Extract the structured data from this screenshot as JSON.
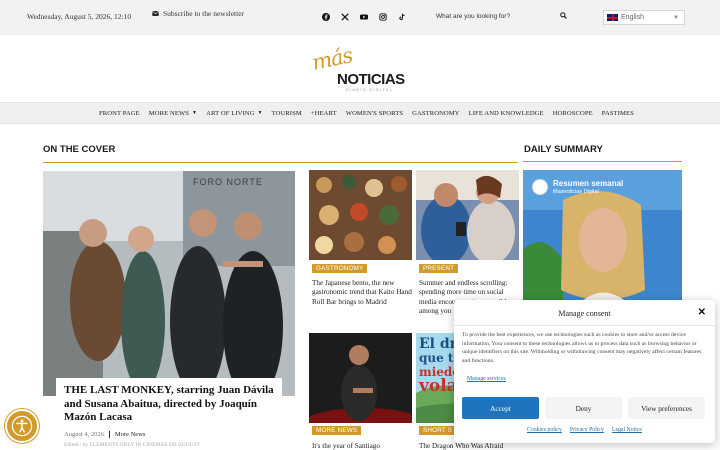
{
  "topbar": {
    "date": "Wednesday, August 5, 2026, 12:10",
    "newsletter": "Subscribe to the newsletter",
    "search_placeholder": "What are you looking for?",
    "language": "English",
    "social_icons": [
      "facebook-icon",
      "x-icon",
      "youtube-icon",
      "instagram-icon",
      "tiktok-icon"
    ]
  },
  "logo": {
    "word1": "más",
    "word2": "NOTICIAS",
    "tagline": "DIARIO DIGITAL"
  },
  "nav": {
    "items": [
      {
        "label": "FRONT PAGE",
        "dropdown": false
      },
      {
        "label": "MORE NEWS",
        "dropdown": true
      },
      {
        "label": "ART OF LIVING",
        "dropdown": true
      },
      {
        "label": "TOURISM",
        "dropdown": false
      },
      {
        "label": "+HEART",
        "dropdown": false
      },
      {
        "label": "WOMEN'S SPORTS",
        "dropdown": false
      },
      {
        "label": "GASTRONOMY",
        "dropdown": false
      },
      {
        "label": "LIFE AND KNOWLEDGE",
        "dropdown": false
      },
      {
        "label": "HOROSCOPE",
        "dropdown": false
      },
      {
        "label": "PASTIMES",
        "dropdown": false
      }
    ]
  },
  "cover": {
    "heading": "ON THE COVER",
    "feature": {
      "sign_text": "FORO NORTE",
      "title": "THE LAST MONKEY, starring Juan Dávila and Susana Abaitua, directed by Joaquín Mazón Lacasa",
      "date": "August 4, 2026",
      "category": "More News",
      "excerpt": "Edited / by ELEMENTS ONLY IN CINEMAS ON AUGUST"
    },
    "cards": [
      {
        "badge": "GASTRONOMY",
        "title": "The Japanese bento, the new gastronomic trend that Kaito Hand Roll Bar brings to Madrid"
      },
      {
        "badge": "PRESENT",
        "title": "Summer and endless scrolling: spending more time on social media encourages irresponsible among you"
      },
      {
        "badge": "MORE NEWS",
        "title": "It's the year of Santiago"
      },
      {
        "badge": "SHORT S",
        "title": "The Dragon Who Was Afraid",
        "image_text": [
          "El drag",
          "que ten",
          "miedo",
          "vola"
        ]
      }
    ]
  },
  "daily": {
    "heading": "DAILY SUMMARY",
    "card_title": "Resumen semanal",
    "card_sub": "Masnoticias Digital"
  },
  "consent": {
    "title": "Manage consent",
    "body": "To provide the best experiences, we use technologies such as cookies to store and/or access device information. Your consent to these technologies allows us to process data such as browsing behavior or unique identifiers on this site. Withholding or withdrawing consent may negatively affect certain features and functions.",
    "manage_services": "Manage services",
    "accept": "Accept",
    "deny": "Deny",
    "preferences": "View preferences",
    "links": [
      "Cookies policy",
      "Privacy Policy",
      "Legal Notice"
    ]
  },
  "colors": {
    "accent": "#d29a2b",
    "button_blue": "#1e73be",
    "link_blue": "#2271b1"
  }
}
